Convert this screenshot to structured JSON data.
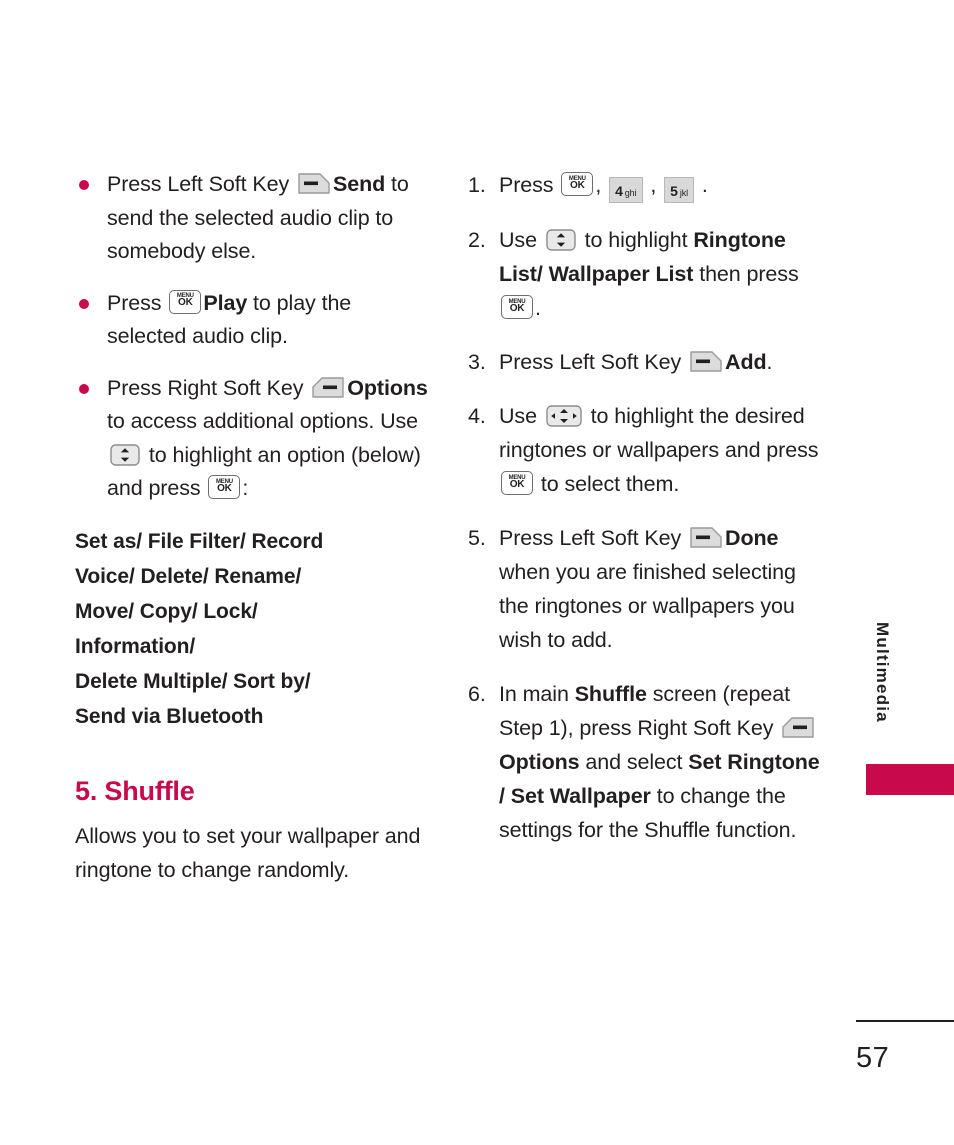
{
  "page": {
    "number": "57",
    "side_label": "Multimedia",
    "accent_color": "#c8094c",
    "text_color": "#231f20"
  },
  "left_column": {
    "bullets": [
      {
        "segments": [
          {
            "type": "text",
            "value": "Press Left Soft Key "
          },
          {
            "type": "icon",
            "icon": "left-soft-key"
          },
          {
            "type": "bold",
            "value": "Send"
          },
          {
            "type": "text",
            "value": " to send the selected audio clip to somebody else."
          }
        ]
      },
      {
        "segments": [
          {
            "type": "text",
            "value": "Press "
          },
          {
            "type": "icon",
            "icon": "menu-ok-key"
          },
          {
            "type": "bold",
            "value": "Play"
          },
          {
            "type": "text",
            "value": " to play the selected audio clip."
          }
        ]
      },
      {
        "segments": [
          {
            "type": "text",
            "value": "Press Right Soft Key "
          },
          {
            "type": "icon",
            "icon": "right-soft-key"
          },
          {
            "type": "bold",
            "value": "Options"
          },
          {
            "type": "text",
            "value": " to access additional options. Use "
          },
          {
            "type": "icon",
            "icon": "nav-updown-key"
          },
          {
            "type": "text",
            "value": " to highlight an option (below) and press "
          },
          {
            "type": "icon",
            "icon": "menu-ok-key"
          },
          {
            "type": "text",
            "value": ":"
          }
        ]
      }
    ],
    "options_list": [
      "Set as/ File Filter/ Record",
      "Voice/ Delete/ Rename/",
      "Move/ Copy/ Lock/",
      "Information/",
      "Delete Multiple/ Sort by/",
      "Send via Bluetooth"
    ],
    "section": {
      "heading": "5. Shuffle",
      "body": "Allows you to set your wallpaper and ringtone to change randomly."
    }
  },
  "right_column": {
    "steps": [
      {
        "number": "1.",
        "segments": [
          {
            "type": "text",
            "value": "Press "
          },
          {
            "type": "icon",
            "icon": "menu-ok-key"
          },
          {
            "type": "text",
            "value": ", "
          },
          {
            "type": "icon",
            "icon": "num-key-4"
          },
          {
            "type": "text",
            "value": " , "
          },
          {
            "type": "icon",
            "icon": "num-key-5"
          },
          {
            "type": "text",
            "value": " ."
          }
        ]
      },
      {
        "number": "2.",
        "segments": [
          {
            "type": "text",
            "value": "Use "
          },
          {
            "type": "icon",
            "icon": "nav-updown-key"
          },
          {
            "type": "text",
            "value": " to highlight "
          },
          {
            "type": "bold",
            "value": "Ringtone List/ Wallpaper List"
          },
          {
            "type": "text",
            "value": " then press "
          },
          {
            "type": "icon",
            "icon": "menu-ok-key"
          },
          {
            "type": "text",
            "value": "."
          }
        ]
      },
      {
        "number": "3.",
        "segments": [
          {
            "type": "text",
            "value": "Press Left Soft Key "
          },
          {
            "type": "icon",
            "icon": "left-soft-key"
          },
          {
            "type": "bold",
            "value": "Add"
          },
          {
            "type": "text",
            "value": "."
          }
        ]
      },
      {
        "number": "4.",
        "segments": [
          {
            "type": "text",
            "value": "Use "
          },
          {
            "type": "icon",
            "icon": "nav-4way-key"
          },
          {
            "type": "text",
            "value": " to highlight the desired ringtones or wallpapers and press "
          },
          {
            "type": "icon",
            "icon": "menu-ok-key"
          },
          {
            "type": "text",
            "value": " to select them."
          }
        ]
      },
      {
        "number": "5.",
        "segments": [
          {
            "type": "text",
            "value": "Press Left Soft Key "
          },
          {
            "type": "icon",
            "icon": "left-soft-key"
          },
          {
            "type": "bold",
            "value": "Done"
          },
          {
            "type": "text",
            "value": " when you are finished selecting the ringtones or wallpapers you wish to add."
          }
        ]
      },
      {
        "number": "6.",
        "segments": [
          {
            "type": "text",
            "value": "In main "
          },
          {
            "type": "bold",
            "value": "Shuffle"
          },
          {
            "type": "text",
            "value": " screen (repeat Step 1), press Right Soft Key "
          },
          {
            "type": "icon",
            "icon": "right-soft-key"
          },
          {
            "type": "bold",
            "value": "Options"
          },
          {
            "type": "text",
            "value": " and select "
          },
          {
            "type": "bold",
            "value": "Set Ringtone / Set Wallpaper"
          },
          {
            "type": "text",
            "value": " to change the settings for the Shuffle function."
          }
        ]
      }
    ]
  },
  "icons": {
    "menu-ok-key": {
      "top": "MENU",
      "bottom": "OK"
    },
    "num-key-4": {
      "digit": "4",
      "letters": "ghi"
    },
    "num-key-5": {
      "digit": "5",
      "letters": "jkl"
    },
    "left-soft-key": {
      "name": "left-soft-key"
    },
    "right-soft-key": {
      "name": "right-soft-key"
    },
    "nav-updown-key": {
      "name": "nav-updown-key"
    },
    "nav-4way-key": {
      "name": "nav-4way-key"
    }
  }
}
